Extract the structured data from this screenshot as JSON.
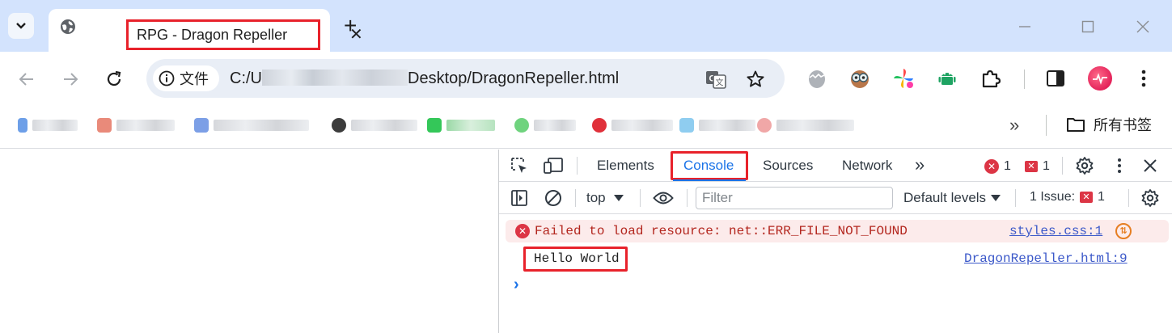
{
  "browser": {
    "tab": {
      "title": "RPG - Dragon Repeller",
      "close": "✕"
    },
    "new_tab": "+",
    "address": {
      "chip_label": "文件",
      "url_prefix": "C:/U",
      "url_suffix": "Desktop/DragonRepeller.html"
    },
    "bookmarks": {
      "more": "»",
      "all_bookmarks": "所有书签"
    },
    "colors": {
      "accent": "#1a73e8",
      "highlight_border": "#e8222b",
      "tabstrip": "#d3e3fd"
    }
  },
  "devtools": {
    "tabs": [
      "Elements",
      "Console",
      "Sources",
      "Network"
    ],
    "active_tab": "Console",
    "more_tabs": "»",
    "error_count": "1",
    "warning_count": "1",
    "console_bar": {
      "context": "top",
      "filter_placeholder": "Filter",
      "levels": "Default levels",
      "issues_label": "1 Issue:",
      "issues_count": "1"
    },
    "messages": [
      {
        "level": "error",
        "text": "Failed to load resource: net::ERR_FILE_NOT_FOUND",
        "source": "styles.css:1"
      },
      {
        "level": "log",
        "text": "Hello World",
        "source": "DragonRepeller.html:9"
      }
    ],
    "prompt": "›"
  }
}
